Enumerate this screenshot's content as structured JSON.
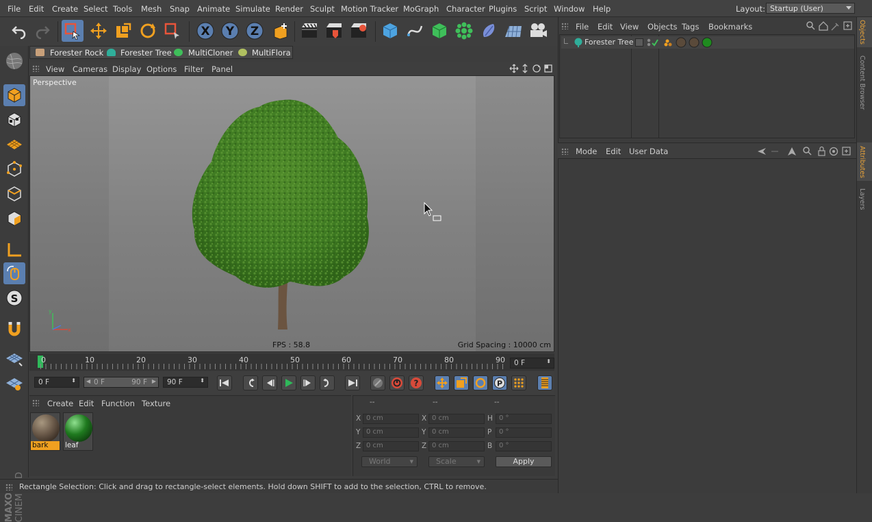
{
  "menubar": {
    "items": [
      "File",
      "Edit",
      "Create",
      "Select",
      "Tools",
      "Mesh",
      "Snap",
      "Animate",
      "Simulate",
      "Render",
      "Sculpt",
      "Motion Tracker",
      "MoGraph",
      "Character",
      "Plugins",
      "Script",
      "Window",
      "Help"
    ],
    "layout_label": "Layout:",
    "layout_value": "Startup (User)"
  },
  "toolbar": {
    "icons": [
      "undo-icon",
      "redo-icon",
      "live-selection-icon",
      "move-icon",
      "scale-icon",
      "rotate-icon",
      "rectangle-selection-icon",
      "x-axis-icon",
      "y-axis-icon",
      "z-axis-icon",
      "coordinate-system-icon",
      "render-view-icon",
      "render-picture-viewer-icon",
      "render-settings-icon",
      "cube-object-icon",
      "spline-pen-icon",
      "nurbs-icon",
      "array-icon",
      "deformer-icon",
      "floor-icon",
      "camera-icon"
    ],
    "axis_labels": [
      "X",
      "Y",
      "Z"
    ]
  },
  "plugins": {
    "items": [
      "Forester Rock",
      "Forester Tree",
      "MultiCloner",
      "MultiFlora"
    ]
  },
  "viewport": {
    "menu": [
      "View",
      "Cameras",
      "Display",
      "Options",
      "Filter",
      "Panel"
    ],
    "camera_label": "Perspective",
    "fps": "FPS : 58.8",
    "grid_spacing": "Grid Spacing : 10000 cm"
  },
  "timeline": {
    "ticks": [
      "0",
      "10",
      "20",
      "30",
      "40",
      "50",
      "60",
      "70",
      "80",
      "90"
    ],
    "current_frame": "0 F"
  },
  "playback": {
    "start_frame": "0 F",
    "range_min": "0 F",
    "range_max": "90 F",
    "end_frame": "90 F"
  },
  "materials": {
    "menu": [
      "Create",
      "Edit",
      "Function",
      "Texture"
    ],
    "items": [
      {
        "name": "bark",
        "color": "#6b5a4a"
      },
      {
        "name": "leaf",
        "color": "#1f7a1f"
      }
    ]
  },
  "coordinates": {
    "header": [
      "--",
      "--",
      "--"
    ],
    "pos_labels": [
      "X",
      "Y",
      "Z"
    ],
    "pos_values": [
      "0 cm",
      "0 cm",
      "0 cm"
    ],
    "size_labels": [
      "X",
      "Y",
      "Z"
    ],
    "size_values": [
      "0 cm",
      "0 cm",
      "0 cm"
    ],
    "rot_labels": [
      "H",
      "P",
      "B"
    ],
    "rot_values": [
      "0 °",
      "0 °",
      "0 °"
    ],
    "mode_world": "World",
    "mode_scale": "Scale",
    "apply": "Apply"
  },
  "status": {
    "text": "Rectangle Selection: Click and drag to rectangle-select elements. Hold down SHIFT to add to the selection, CTRL to remove."
  },
  "objects": {
    "menu": [
      "File",
      "Edit",
      "View",
      "Objects",
      "Tags",
      "Bookmarks"
    ],
    "items": [
      {
        "name": "Forester Tree"
      }
    ]
  },
  "attributes": {
    "menu": [
      "Mode",
      "Edit",
      "User Data"
    ]
  },
  "right_tabs": [
    "Objects",
    "Content Browser",
    "Attributes",
    "Layers"
  ],
  "logo": {
    "line1": "MAXON",
    "line2": "CINEMA 4D"
  },
  "colors": {
    "accent": "#e8a33a",
    "tree_green": "#4f8a2a",
    "select_green": "#2fb85a"
  }
}
